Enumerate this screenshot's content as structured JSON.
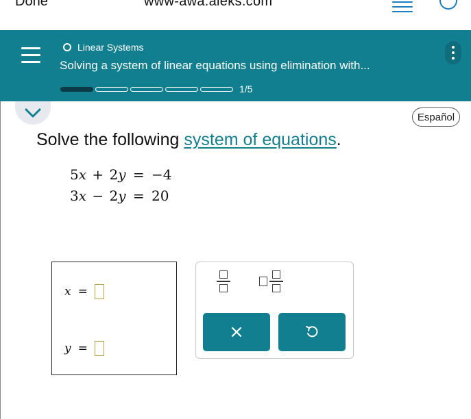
{
  "browser": {
    "done_label": "Done",
    "url": "www-awa.aleks.com"
  },
  "header": {
    "topic": "Linear Systems",
    "subtitle": "Solving a system of linear equations using elimination with...",
    "progress": {
      "current": 1,
      "total": 5,
      "label": "1/5"
    },
    "accent_color": "#127f91"
  },
  "language_button": "Español",
  "question": {
    "prefix": "Solve the following ",
    "link_text": "system of equations",
    "suffix": "."
  },
  "equations": [
    {
      "a": "5",
      "x": "x",
      "op": "+",
      "b": "2",
      "y": "y",
      "eq": "=",
      "rhs": "−4"
    },
    {
      "a": "3",
      "x": "x",
      "op": "−",
      "b": "2",
      "y": "y",
      "eq": "=",
      "rhs": "20"
    }
  ],
  "answers": [
    {
      "var": "x",
      "eq": "=",
      "value": ""
    },
    {
      "var": "y",
      "eq": "=",
      "value": ""
    }
  ],
  "tools": {
    "clear_symbol": "×",
    "undo_icon": "undo-icon"
  }
}
